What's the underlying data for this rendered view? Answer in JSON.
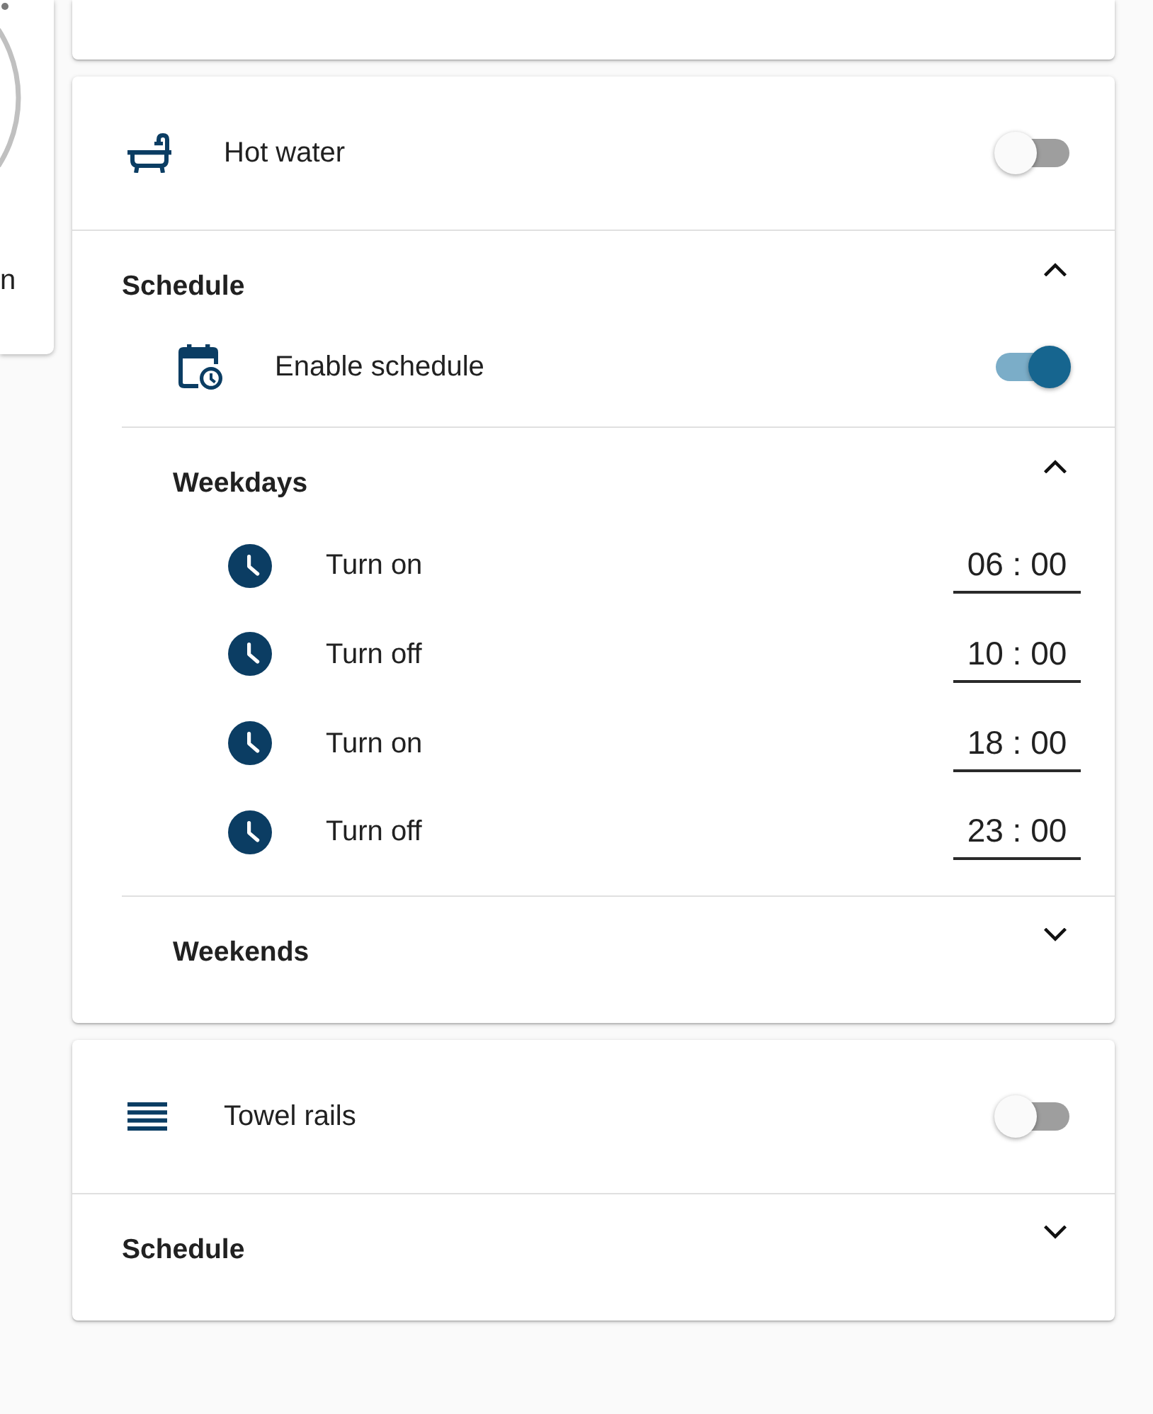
{
  "side_card": {
    "label": "n"
  },
  "devices": [
    {
      "kind": "hot-water",
      "name": "Hot water",
      "on": false,
      "schedule": {
        "title": "Schedule",
        "expanded": true,
        "enable": {
          "label": "Enable schedule",
          "on": true
        },
        "groups": [
          {
            "title": "Weekdays",
            "expanded": true,
            "entries": [
              {
                "label": "Turn on",
                "time": "06 : 00"
              },
              {
                "label": "Turn off",
                "time": "10 : 00"
              },
              {
                "label": "Turn on",
                "time": "18 : 00"
              },
              {
                "label": "Turn off",
                "time": "23 : 00"
              }
            ]
          },
          {
            "title": "Weekends",
            "expanded": false
          }
        ]
      }
    },
    {
      "kind": "towel-rail",
      "name": "Towel rails",
      "on": false,
      "schedule": {
        "title": "Schedule",
        "expanded": false
      }
    }
  ]
}
